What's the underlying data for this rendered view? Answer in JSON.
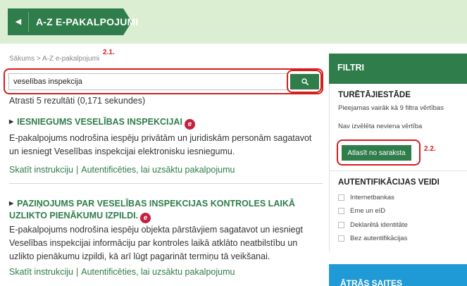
{
  "header": {
    "back_glyph": "◀",
    "title": "A-Z E-PAKALPOJUMI"
  },
  "breadcrumb": {
    "home": "Sākums",
    "separator": ">",
    "current": "A-Z e-pakalpojumi"
  },
  "annotations": {
    "step1": "2.1.",
    "step2": "2.2."
  },
  "search": {
    "value": "veselības inspekcija",
    "button_icon": "search-icon"
  },
  "results_count": "Atrasti 5 rezultāti (0,171 sekundes)",
  "results": [
    {
      "title": "IESNIEGUMS VESELĪBAS INSPEKCIJAI",
      "desc": "E-pakalpojums nodrošina iespēju privātām un juridiskām personām sagatavot un iesniegt Veselības inspekcijai elektronisku iesniegumu.",
      "link_instructions": "Skatīt instrukciju",
      "link_separator": "|",
      "link_auth": "Autentificēties, lai uzsāktu pakalpojumu"
    },
    {
      "title": "PAZIŅOJUMS PAR VESELĪBAS INSPEKCIJAS KONTROLES LAIKĀ UZLIKTO PIENĀKUMU IZPILDI.",
      "desc": "E-pakalpojums nodrošina iespēju objekta pārstāvjiem sagatavot un iesniegt Veselības inspekcijai informāciju par kontroles laikā atklāto neatbilstību un uzlikto pienākumu izpildi, kā arī lūgt pagarināt termiņu tā veikšanai.",
      "link_instructions": "Skatīt instrukciju",
      "link_separator": "|",
      "link_auth": "Autentificēties, lai uzsāktu pakalpojumu"
    }
  ],
  "eservice_badge": "e",
  "sidebar": {
    "filters_title": "FILTRI",
    "institution": {
      "title": "TURĒTĀJIESTĀDE",
      "available": "Pieejamas vairāk kā 9 filtra vērtības",
      "none_selected": "Nav izvēlēta neviena vērtība",
      "select_button": "Atlasīt no saraksta"
    },
    "auth": {
      "title": "AUTENTIFIKĀCIJAS VEIDI",
      "options": [
        "Internetbankas",
        "Eme un eID",
        "Deklarētā identitāte",
        "Bez autentifikācijas"
      ]
    },
    "quick_links_title": "ĀTRĀS SAITES"
  },
  "colors": {
    "accent_green": "#2e7d4a",
    "header_bg": "#dbeed1",
    "annotation_red": "#d51e1e",
    "quick_blue": "#1f9ad6",
    "e_badge": "#c61f3c"
  }
}
